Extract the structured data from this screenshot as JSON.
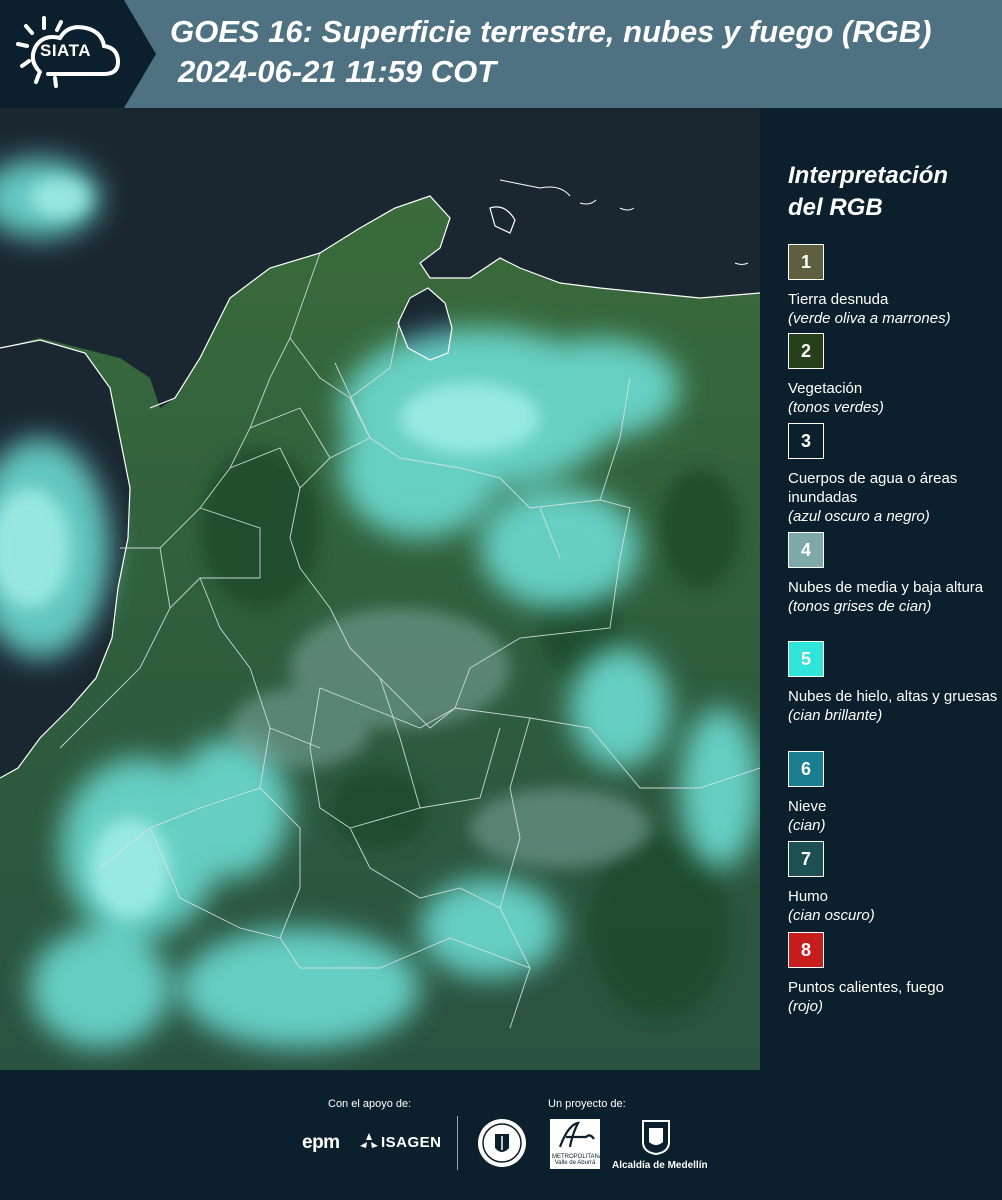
{
  "header": {
    "logo_text": "SIATA",
    "title": "GOES 16: Superficie terrestre, nubes y fuego (RGB)",
    "subtitle": "2024-06-21 11:59 COT"
  },
  "legend": {
    "title": "Interpretación del RGB",
    "items": [
      {
        "number": "1",
        "label": "Tierra desnuda",
        "sub": "(verde oliva a marrones)",
        "color": "#5f5e3e"
      },
      {
        "number": "2",
        "label": "Vegetación",
        "sub": "(tonos verdes)",
        "color": "#283f1c"
      },
      {
        "number": "3",
        "label": "Cuerpos de agua o áreas inundadas",
        "sub": "(azul oscuro a negro)",
        "color": "#0c1f2c"
      },
      {
        "number": "4",
        "label": "Nubes de media y baja altura",
        "sub": "(tonos grises de cian)",
        "color": "#7fa8a8"
      },
      {
        "number": "5",
        "label": "Nubes de hielo, altas y gruesas",
        "sub": "(cian brillante)",
        "color": "#2fe4d9"
      },
      {
        "number": "6",
        "label": "Nieve",
        "sub": "(cian)",
        "color": "#1b7e90"
      },
      {
        "number": "7",
        "label": "Humo",
        "sub": "(cian oscuro)",
        "color": "#1d5054"
      },
      {
        "number": "8",
        "label": "Puntos calientes, fuego",
        "sub": "(rojo)",
        "color": "#c71d1d"
      }
    ]
  },
  "footer": {
    "support_label": "Con el apoyo de:",
    "project_label": "Un proyecto de:",
    "epm": "epm",
    "isagen": "ISAGEN",
    "area_text": "METROPOLITANA Valle de Aburrá",
    "alcaldia": "Alcaldía de Medellín"
  },
  "colors": {
    "header_bg": "#4e7281",
    "page_bg": "#0c1f2c",
    "ocean": "#1a2630",
    "land": "#2c5a3c",
    "cloud": "#6fe3da"
  }
}
